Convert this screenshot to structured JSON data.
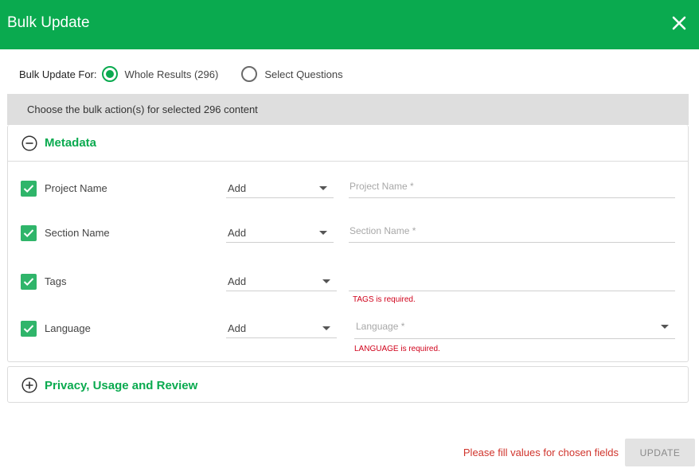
{
  "header": {
    "title": "Bulk Update",
    "close_icon": "close-icon"
  },
  "bulk_for": {
    "label": "Bulk Update For:",
    "options": [
      {
        "label": "Whole Results (296)",
        "selected": true
      },
      {
        "label": "Select Questions",
        "selected": false
      }
    ]
  },
  "info": {
    "text": "Choose the bulk action(s) for selected 296 content"
  },
  "metadata": {
    "title": "Metadata",
    "expanded": true,
    "rows": [
      {
        "label": "Project Name",
        "checked": true,
        "operation": "Add",
        "placeholder": "Project Name *",
        "value": "",
        "error": ""
      },
      {
        "label": "Section Name",
        "checked": true,
        "operation": "Add",
        "placeholder": "Section Name *",
        "value": "",
        "error": ""
      },
      {
        "label": "Tags",
        "checked": true,
        "operation": "Add",
        "placeholder": "",
        "value": "",
        "error": "TAGS is required."
      },
      {
        "label": "Language",
        "checked": true,
        "operation": "Add",
        "placeholder": "Language *",
        "value": "",
        "error": "LANGUAGE is required."
      }
    ]
  },
  "privacy": {
    "title": "Privacy, Usage and Review",
    "expanded": false
  },
  "footer": {
    "message": "Please fill values for chosen fields",
    "update_label": "UPDATE"
  },
  "colors": {
    "brand": "#0aaa4f",
    "error": "#d0021b",
    "checkbox": "#2fb56a"
  }
}
